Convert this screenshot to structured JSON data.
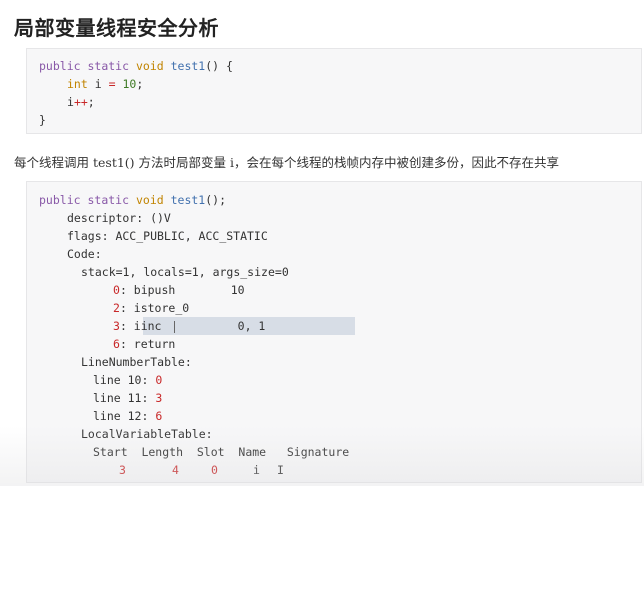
{
  "heading": "局部变量线程安全分析",
  "code1": {
    "line1": {
      "kw1": "public",
      "kw2": "static",
      "ty": "void",
      "fn": "test1",
      "rest": "() {"
    },
    "line2": {
      "ty": "int",
      "var": "i",
      "op": "=",
      "num": "10",
      "end": ";"
    },
    "line3": {
      "var": "i",
      "op": "++",
      "end": ";"
    },
    "line4": "}"
  },
  "paragraph": {
    "part1": "每个线程调用 ",
    "method": "test1()",
    "part2": " 方法时局部变量 ",
    "var": "i",
    "part3": "，会在每个线程的栈帧内存中被创建多份，因此不存在共享"
  },
  "code2": {
    "sig": {
      "kw1": "public",
      "kw2": "static",
      "ty": "void",
      "fn": "test1",
      "rest": "();"
    },
    "descriptor": "descriptor: ()V",
    "flags": "flags: ACC_PUBLIC, ACC_STATIC",
    "code_label": "Code:",
    "stack": {
      "a": "stack",
      "b": "=1, locals",
      "c": "=1, args_size",
      "d": "=0"
    },
    "instr": [
      {
        "idx": "0",
        "rest": ": bipush        ",
        "arg": "10"
      },
      {
        "idx": "2",
        "rest": ": istore_0",
        "arg": ""
      },
      {
        "idx": "3",
        "rest": ": iinc           ",
        "arg": "0, 1"
      },
      {
        "idx": "6",
        "rest": ": return",
        "arg": ""
      }
    ],
    "lnt_label": "LineNumberTable:",
    "lnt": [
      {
        "a": "line 10: ",
        "b": "0"
      },
      {
        "a": "line 11: ",
        "b": "3"
      },
      {
        "a": "line 12: ",
        "b": "6"
      }
    ],
    "lvt_label": "LocalVariableTable:",
    "lvt_header": "Start  Length  Slot  Name   Signature",
    "lvt_row": {
      "start": "3",
      "length": "4",
      "slot": "0",
      "name": "i",
      "sig": "I"
    }
  }
}
